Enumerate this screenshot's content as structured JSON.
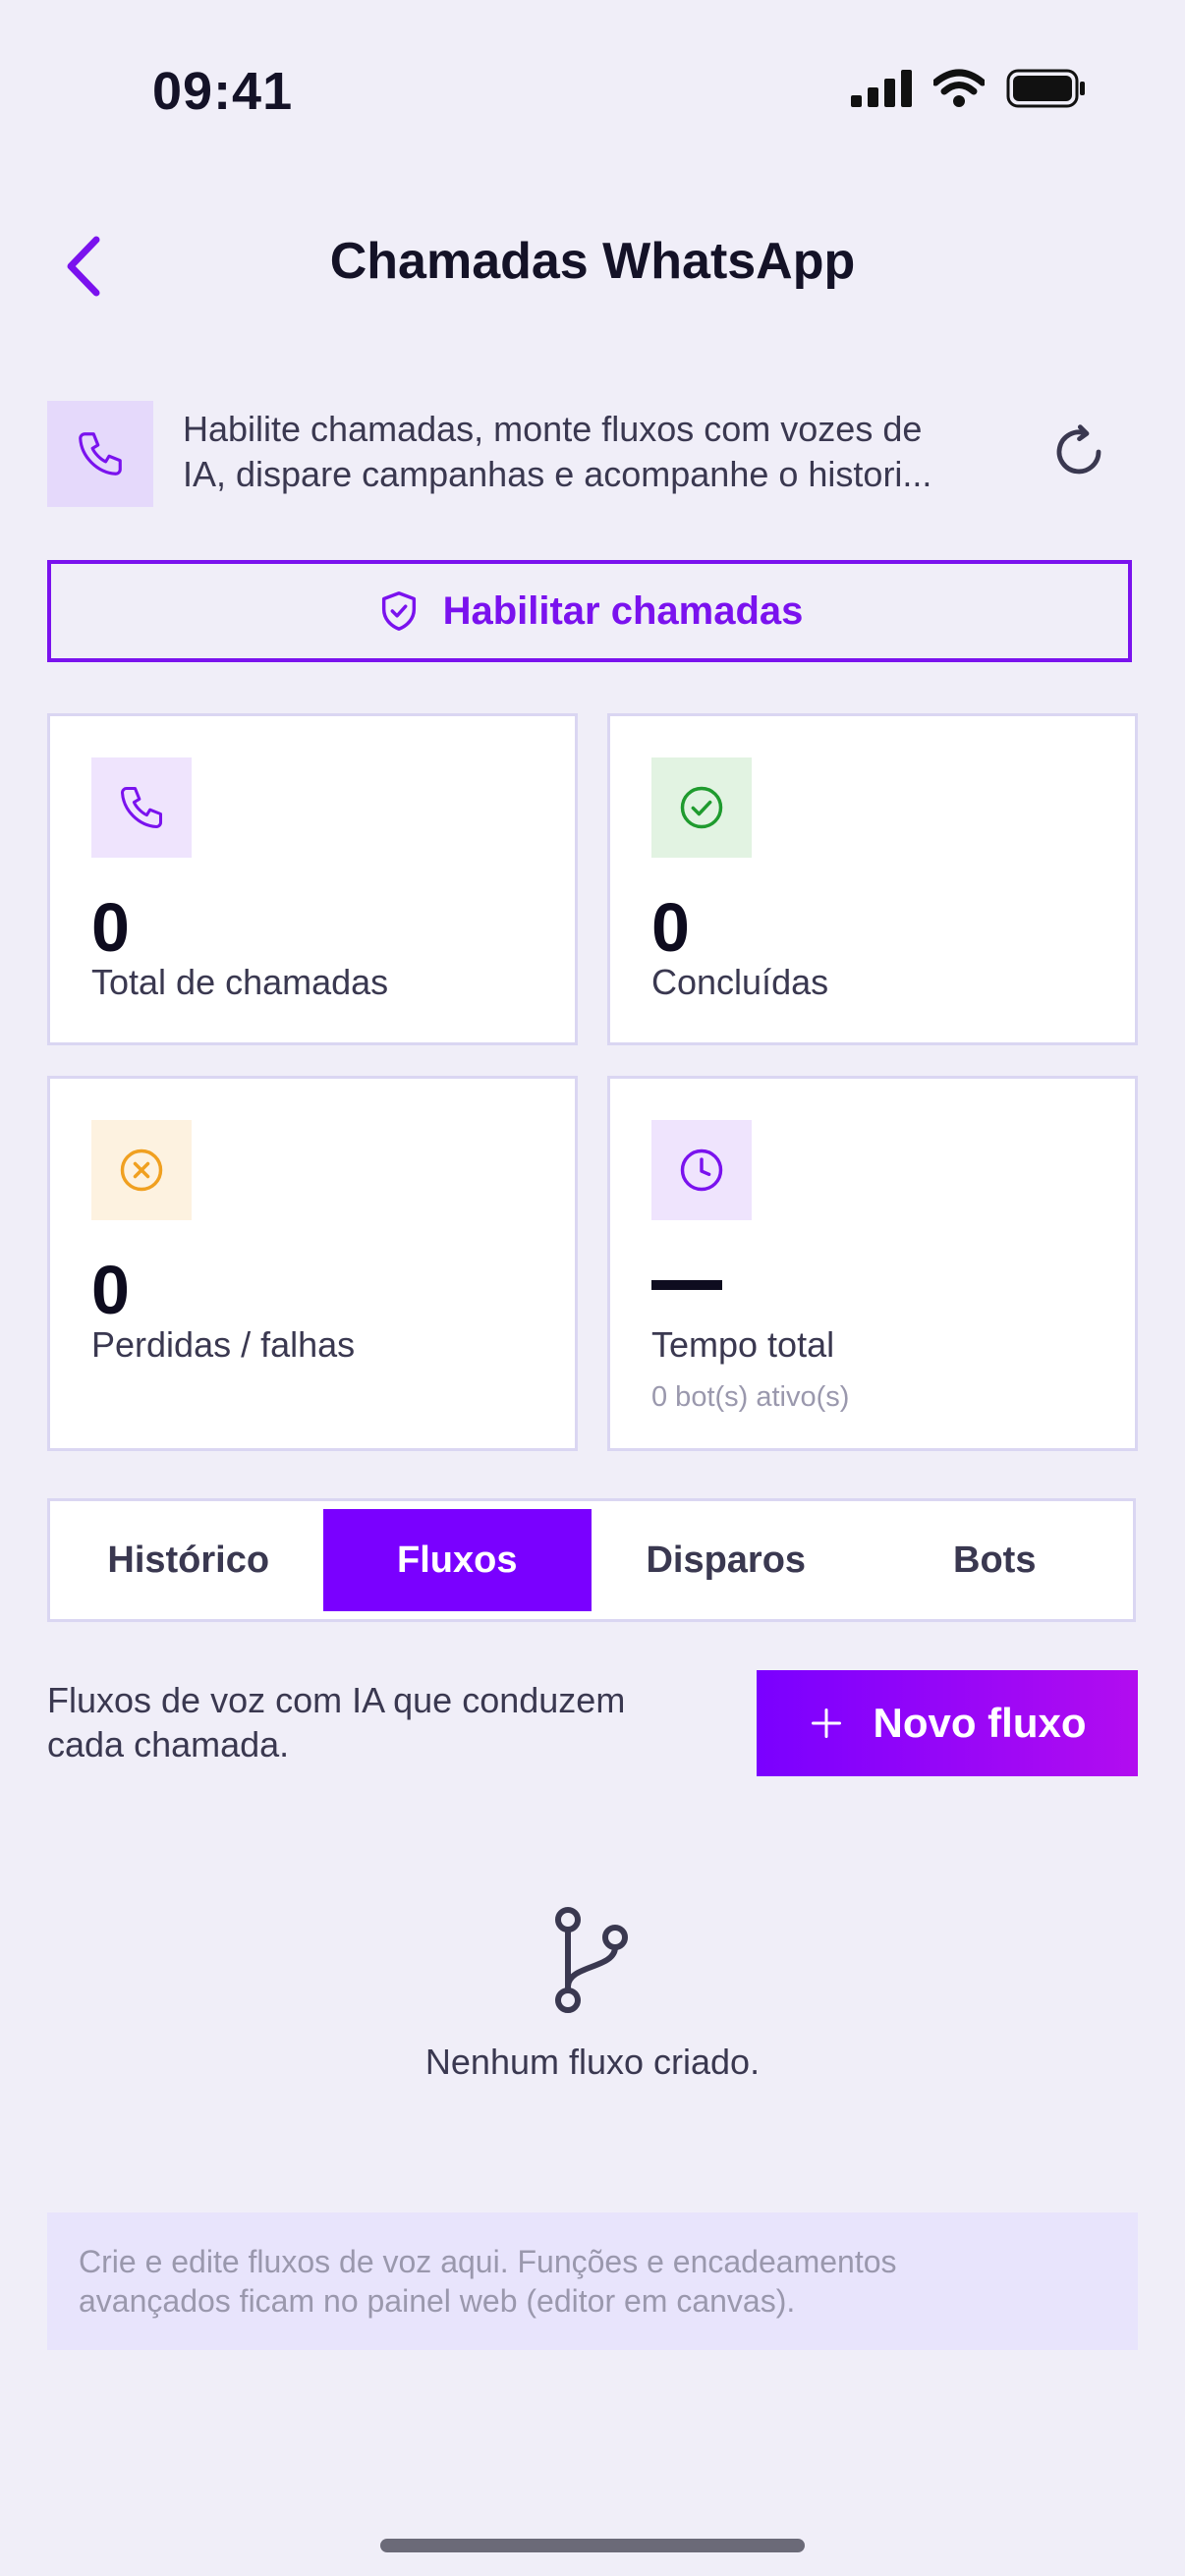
{
  "status_bar": {
    "time": "09:41"
  },
  "header": {
    "title": "Chamadas WhatsApp"
  },
  "intro": {
    "line1": "Habilite chamadas, monte fluxos com vozes de",
    "line2": "IA, dispare campanhas e acompanhe o histori..."
  },
  "enable_button": {
    "label": "Habilitar chamadas"
  },
  "stats": [
    {
      "value": "0",
      "label": "Total de chamadas",
      "icon": "phone-icon",
      "color": "#7a12ee",
      "bg": "#efe4fd"
    },
    {
      "value": "0",
      "label": "Concluídas",
      "icon": "check-circle-icon",
      "color": "#1f9b2e",
      "bg": "#e2f3e2"
    },
    {
      "value": "0",
      "label": "Perdidas / falhas",
      "icon": "x-circle-icon",
      "color": "#f0a020",
      "bg": "#fdf2e0"
    },
    {
      "value": "—",
      "label": "Tempo total",
      "sub": "0 bot(s) ativo(s)",
      "icon": "clock-icon",
      "color": "#7a12ee",
      "bg": "#efe4fd"
    }
  ],
  "tabs": [
    {
      "label": "Histórico",
      "active": false
    },
    {
      "label": "Fluxos",
      "active": true
    },
    {
      "label": "Disparos",
      "active": false
    },
    {
      "label": "Bots",
      "active": false
    }
  ],
  "flows": {
    "description_line1": "Fluxos de voz com IA que conduzem",
    "description_line2": "cada chamada.",
    "new_button": "Novo fluxo",
    "empty_text": "Nenhum fluxo criado."
  },
  "note": {
    "line1": "Crie e edite fluxos de voz aqui. Funções e encadeamentos",
    "line2": "avançados ficam no painel web (editor em canvas)."
  },
  "colors": {
    "accent": "#7a00ff",
    "background": "#f0eef8"
  }
}
